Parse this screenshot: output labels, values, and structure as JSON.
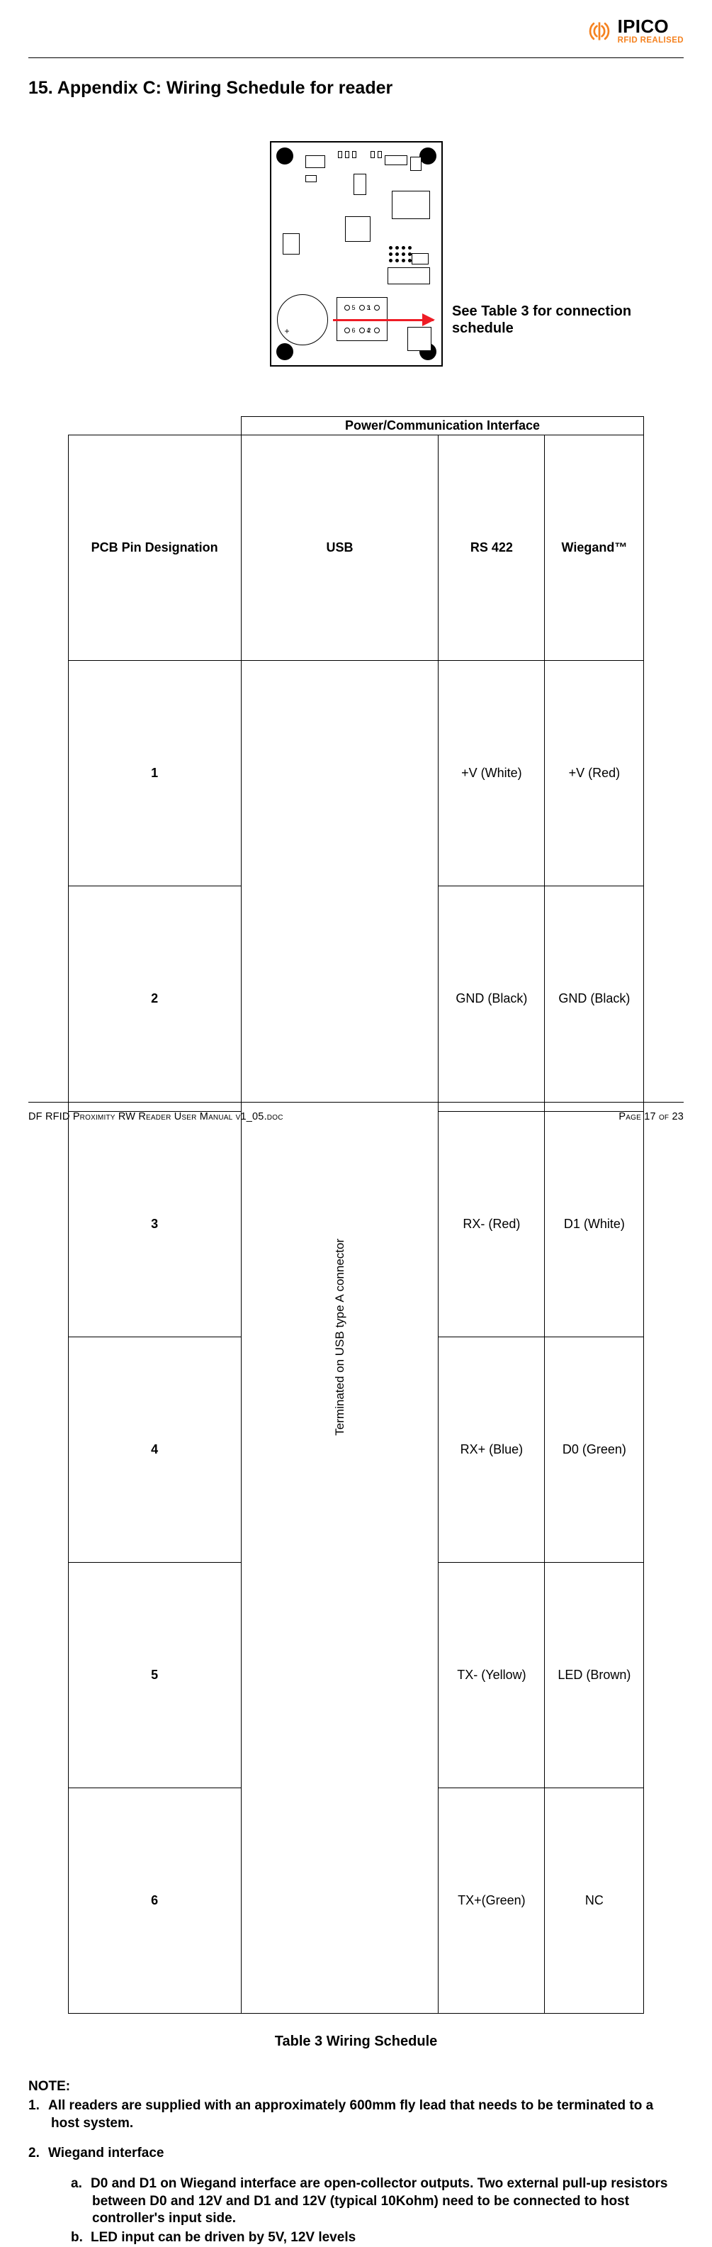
{
  "logo": {
    "brand": "IPICO",
    "tag": "RFID REALISED"
  },
  "heading": "15.  Appendix C: Wiring Schedule for reader",
  "callout": "See Table 3 for connection schedule",
  "table": {
    "group_header": "Power/Communication Interface",
    "col_pcb": "PCB Pin Designation",
    "col_usb": "USB",
    "col_rs": "RS 422",
    "col_wg": "Wiegand™",
    "usb_note": "Terminated on USB type A connector",
    "rows": [
      {
        "pin": "1",
        "rs": "+V (White)",
        "wg": "+V (Red)"
      },
      {
        "pin": "2",
        "rs": "GND (Black)",
        "wg": "GND (Black)"
      },
      {
        "pin": "3",
        "rs": "RX- (Red)",
        "wg": "D1 (White)"
      },
      {
        "pin": "4",
        "rs": "RX+ (Blue)",
        "wg": "D0 (Green)"
      },
      {
        "pin": "5",
        "rs": "TX- (Yellow)",
        "wg": "LED (Brown)"
      },
      {
        "pin": "6",
        "rs": "TX+(Green)",
        "wg": "NC"
      }
    ]
  },
  "table_caption": "Table 3 Wiring Schedule",
  "notes": {
    "heading": "NOTE:",
    "n1": "All readers are supplied with an approximately 600mm fly lead that needs to be terminated to a host system.",
    "n2_title": "Wiegand interface",
    "n2a": "D0 and D1 on Wiegand interface are open-collector outputs. Two external pull-up resistors between D0 and 12V and D1 and 12V (typical 10Kohm) need to be connected to host controller's input side.",
    "n2b": "LED input can be driven by 5V, 12V levels"
  },
  "footer": {
    "left": "DF RFID Proximity RW Reader User Manual v1_05.doc",
    "right": "Page 17 of 23"
  }
}
